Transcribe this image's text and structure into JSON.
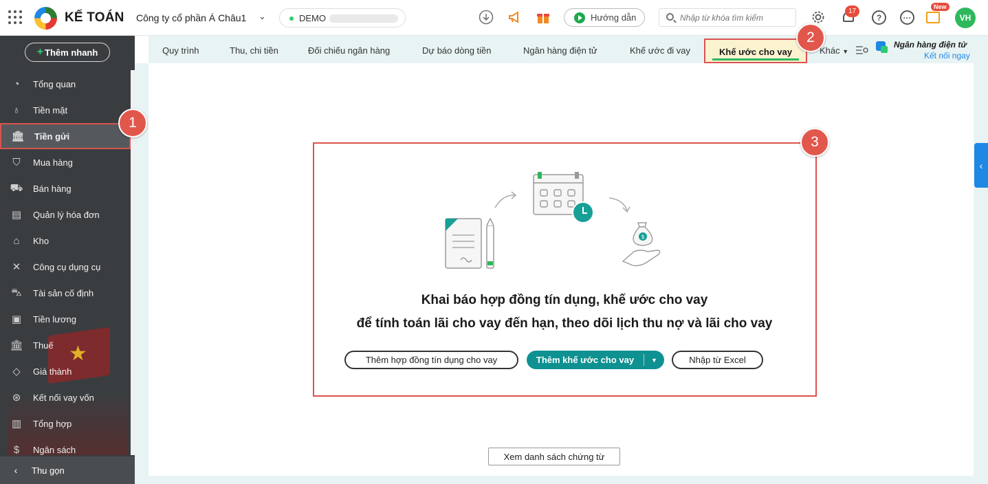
{
  "header": {
    "brand": "KẾ TOÁN",
    "company": "Công ty cổ phần Á Châu1",
    "env_label": "DEMO",
    "guide_label": "Hướng dẫn",
    "search_placeholder": "Nhập từ khóa tìm kiếm",
    "notification_count": "17",
    "new_badge": "New",
    "avatar_initials": "VH"
  },
  "sidebar": {
    "quick_add": "Thêm nhanh",
    "items": [
      {
        "label": "Tổng quan",
        "icon": "chart-pie-icon"
      },
      {
        "label": "Tiền mặt",
        "icon": "money-bag-icon"
      },
      {
        "label": "Tiền gửi",
        "icon": "bank-icon"
      },
      {
        "label": "Mua hàng",
        "icon": "shopping-bag-icon"
      },
      {
        "label": "Bán hàng",
        "icon": "cart-icon"
      },
      {
        "label": "Quản lý hóa đơn",
        "icon": "invoice-icon"
      },
      {
        "label": "Kho",
        "icon": "warehouse-icon"
      },
      {
        "label": "Công cụ dụng cụ",
        "icon": "tools-icon"
      },
      {
        "label": "Tài sản cố định",
        "icon": "asset-icon"
      },
      {
        "label": "Tiền lương",
        "icon": "salary-icon"
      },
      {
        "label": "Thuế",
        "icon": "tax-icon"
      },
      {
        "label": "Giá thành",
        "icon": "price-tag-icon"
      },
      {
        "label": "Kết nối vay vốn",
        "icon": "loan-link-icon"
      },
      {
        "label": "Tổng hợp",
        "icon": "summary-icon"
      },
      {
        "label": "Ngân sách",
        "icon": "budget-icon"
      }
    ],
    "collapse_label": "Thu gọn"
  },
  "tabs": {
    "items": [
      "Quy trình",
      "Thu, chi tiền",
      "Đối chiếu ngân hàng",
      "Dự báo dòng tiền",
      "Ngân hàng điện tử",
      "Khế ước đi vay",
      "Khế ước cho vay"
    ],
    "more_label": "Khác",
    "bank_title": "Ngân hàng điện tử",
    "bank_link": "Kết nối ngay"
  },
  "empty_state": {
    "line1": "Khai báo hợp đồng tín dụng, khế ước cho vay",
    "line2": "để tính toán lãi cho vay đến hạn, theo dõi lịch thu nợ và lãi cho vay",
    "btn_credit_contract": "Thêm hợp đồng tín dụng cho vay",
    "btn_add_loan": "Thêm khế ước cho vay",
    "btn_import_excel": "Nhập từ Excel"
  },
  "footer": {
    "view_vouchers": "Xem danh sách chứng từ"
  },
  "callouts": {
    "one": "1",
    "two": "2",
    "three": "3"
  },
  "colors": {
    "accent": "#0f9191",
    "highlight": "#d9534f",
    "active_tab_bg": "#fbf3cf",
    "sidebar_bg": "#3a3d40"
  }
}
